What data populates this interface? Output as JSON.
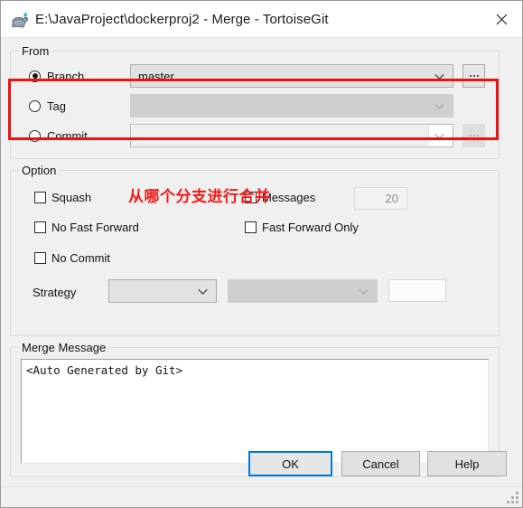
{
  "window": {
    "title": "E:\\JavaProject\\dockerproj2 - Merge - TortoiseGit",
    "icon": "tortoisegit-turtle-icon",
    "close_label": "close-icon"
  },
  "from_group": {
    "title": "From",
    "options": [
      {
        "label": "Branch",
        "selected": true,
        "value": "master",
        "state": "enabled",
        "browse": "...",
        "browse_state": "enabled"
      },
      {
        "label": "Tag",
        "selected": false,
        "value": "",
        "state": "disabled",
        "browse": "",
        "browse_state": "none"
      },
      {
        "label": "Commit",
        "selected": false,
        "value": "",
        "state": "white",
        "browse": "...",
        "browse_state": "disabled"
      }
    ]
  },
  "option_group": {
    "title": "Option",
    "checkboxes_left": [
      {
        "label": "Squash",
        "checked": false
      },
      {
        "label": "No Fast Forward",
        "checked": false
      },
      {
        "label": "No Commit",
        "checked": false
      }
    ],
    "checkboxes_right": [
      {
        "label": "Messages",
        "checked": false
      },
      {
        "label": "Fast Forward Only",
        "checked": false
      }
    ],
    "messages_count": "20",
    "strategy_label": "Strategy",
    "strategy_value": "",
    "strategy_sub_value": "",
    "strategy_extra_value": ""
  },
  "merge_message_group": {
    "title": "Merge Message",
    "text": "<Auto Generated by Git>"
  },
  "buttons": {
    "ok": "OK",
    "cancel": "Cancel",
    "help": "Help"
  },
  "annotation": {
    "text": "从哪个分支进行合并",
    "color": "#f41818"
  }
}
